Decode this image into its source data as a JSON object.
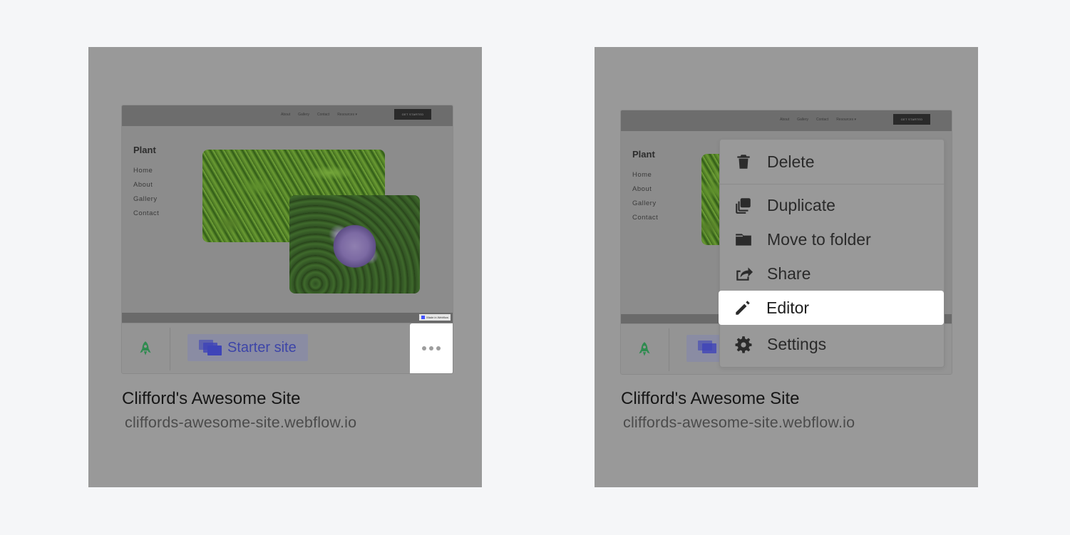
{
  "left_card": {
    "site_preview": {
      "nav_links": [
        "About",
        "Gallery",
        "Contact",
        "Resources ▾"
      ],
      "cta_label": "GET STARTED",
      "brand": "Plant",
      "menu": [
        "Home",
        "About",
        "Gallery",
        "Contact"
      ],
      "badge": "Made in Webflow"
    },
    "plan_label": "Starter site",
    "title": "Clifford's Awesome Site",
    "url": "cliffords-awesome-site.webflow.io"
  },
  "right_card": {
    "site_preview": {
      "nav_links": [
        "About",
        "Gallery",
        "Contact",
        "Resources ▾"
      ],
      "cta_label": "GET STARTED",
      "brand": "Plant",
      "menu": [
        "Home",
        "About",
        "Gallery",
        "Contact"
      ]
    },
    "title": "Clifford's Awesome Site",
    "url": "cliffords-awesome-site.webflow.io"
  },
  "context_menu": {
    "items": [
      {
        "label": "Delete",
        "icon": "trash-icon"
      },
      {
        "label": "Duplicate",
        "icon": "duplicate-icon"
      },
      {
        "label": "Move to folder",
        "icon": "folder-icon"
      },
      {
        "label": "Share",
        "icon": "share-icon"
      },
      {
        "label": "Editor",
        "icon": "pencil-icon",
        "highlighted": true
      },
      {
        "label": "Settings",
        "icon": "gear-icon"
      }
    ]
  },
  "colors": {
    "background": "#f5f6f8",
    "overlay": "#999999",
    "accent": "#3d45a8",
    "rocket_green": "#2e8b4f"
  }
}
